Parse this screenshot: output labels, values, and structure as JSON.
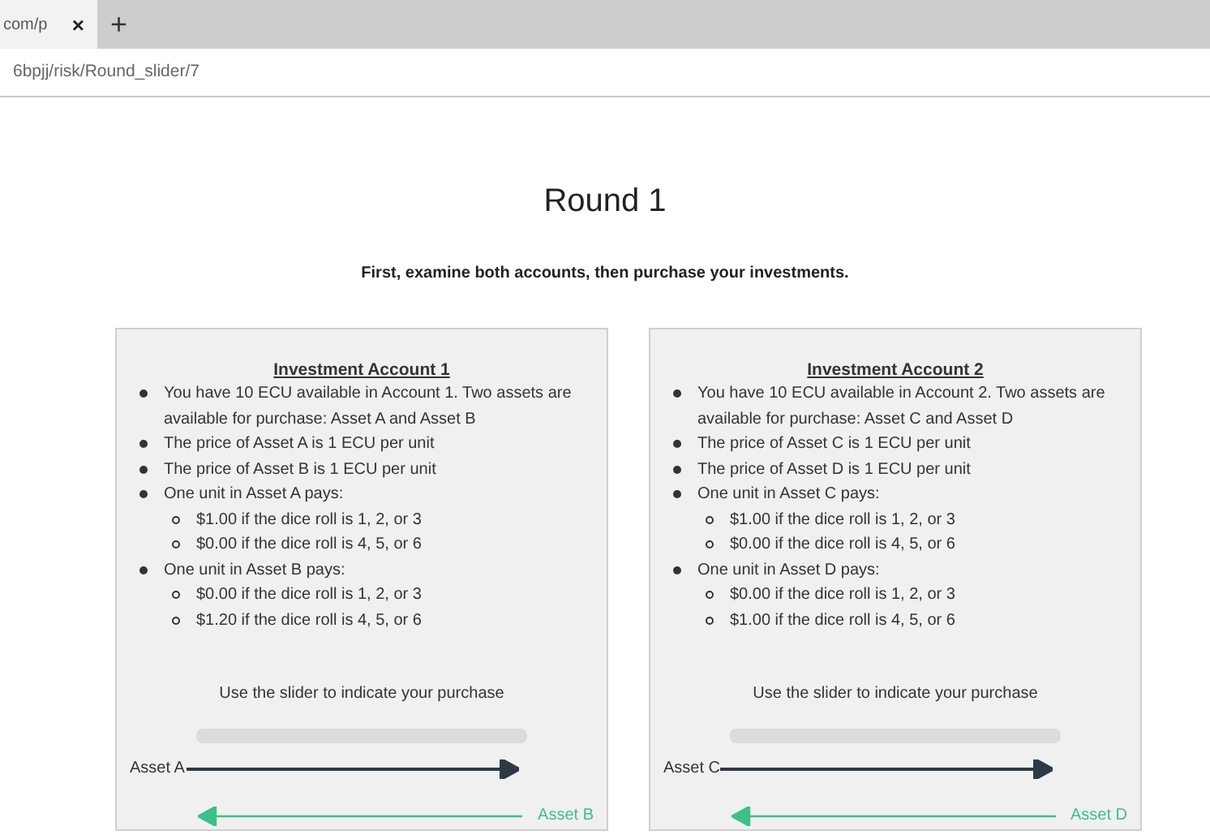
{
  "browser": {
    "tab_title": "com/p",
    "close": "×",
    "new_tab": "+",
    "address": "6bpjj/risk/Round_slider/7"
  },
  "title": "Round 1",
  "instruction": "First, examine both accounts, then purchase your investments.",
  "accounts": [
    {
      "heading": "Investment Account 1",
      "items": [
        {
          "text": "You have 10 ECU available in Account 1. Two assets are available for purchase: Asset A and Asset B"
        },
        {
          "text": "The price of Asset A is 1 ECU per unit"
        },
        {
          "text": "The price of Asset B is 1 ECU per unit"
        },
        {
          "text": "One unit in Asset A pays:",
          "children": [
            {
              "text": "$1.00 if the dice roll is 1, 2, or 3"
            },
            {
              "text": "$0.00 if the dice roll is 4, 5, or 6"
            }
          ]
        },
        {
          "text": "One unit in Asset B pays:",
          "children": [
            {
              "text": "$0.00 if the dice roll is 1, 2, or 3"
            },
            {
              "text": "$1.20 if the dice roll is 4, 5, or 6"
            }
          ]
        }
      ],
      "slider_prompt": "Use the slider to indicate your purchase",
      "left_label": "Asset A",
      "right_label": "Asset B"
    },
    {
      "heading": "Investment Account 2",
      "items": [
        {
          "text": "You have 10 ECU available in Account 2. Two assets are available for purchase: Asset C and Asset D"
        },
        {
          "text": "The price of Asset C is 1 ECU per unit"
        },
        {
          "text": "The price of Asset D is 1 ECU per unit"
        },
        {
          "text": "One unit in Asset C pays:",
          "children": [
            {
              "text": "$1.00 if the dice roll is 1, 2, or 3"
            },
            {
              "text": "$0.00 if the dice roll is 4, 5, or 6"
            }
          ]
        },
        {
          "text": "One unit in Asset D pays:",
          "children": [
            {
              "text": "$0.00 if the dice roll is 1, 2, or 3"
            },
            {
              "text": "$1.00 if the dice roll is 4, 5, or 6"
            }
          ]
        }
      ],
      "slider_prompt": "Use the slider to indicate your purchase",
      "left_label": "Asset C",
      "right_label": "Asset D"
    }
  ]
}
